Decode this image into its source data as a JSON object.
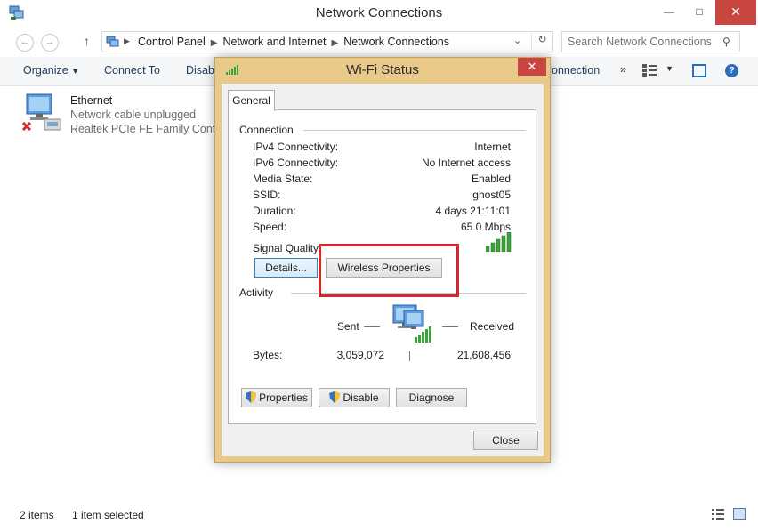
{
  "window": {
    "title": "Network Connections",
    "minimize_icon": "minimize-icon",
    "maximize_icon": "maximize-icon",
    "close_icon": "close-icon"
  },
  "address": {
    "back": "←",
    "forward": "→",
    "up": "↑",
    "breadcrumbs": [
      "Control Panel",
      "Network and Internet",
      "Network Connections"
    ],
    "search_placeholder": "Search Network Connections"
  },
  "toolbar": {
    "organize": "Organize",
    "connect_to": "Connect To",
    "disable": "Disabl",
    "connection": "onnection",
    "more": "»"
  },
  "items": [
    {
      "name": "Ethernet",
      "status": "Network cable unplugged",
      "adapter": "Realtek PCIe FE Family Controll"
    }
  ],
  "statusbar": {
    "count": "2 items",
    "selected": "1 item selected"
  },
  "dialog": {
    "title": "Wi-Fi Status",
    "close": "✕",
    "tab": "General",
    "connection_group": "Connection",
    "rows": [
      {
        "label": "IPv4 Connectivity:",
        "value": "Internet"
      },
      {
        "label": "IPv6 Connectivity:",
        "value": "No Internet access"
      },
      {
        "label": "Media State:",
        "value": "Enabled"
      },
      {
        "label": "SSID:",
        "value": "ghost05"
      },
      {
        "label": "Duration:",
        "value": "4 days 21:11:01"
      },
      {
        "label": "Speed:",
        "value": "65.0 Mbps"
      }
    ],
    "signal_label": "Signal Quality:",
    "signal_bars": 5,
    "details_button": "Details...",
    "wireless_properties_button": "Wireless Properties",
    "activity_group": "Activity",
    "sent_label": "Sent",
    "received_label": "Received",
    "bytes_label": "Bytes:",
    "bytes_sent": "3,059,072",
    "bytes_received": "21,608,456",
    "properties_button": "Properties",
    "disable_button": "Disable",
    "diagnose_button": "Diagnose",
    "close_button": "Close"
  },
  "colors": {
    "accent_close": "#c7463f",
    "dialog_frame": "#e9c98a",
    "highlight": "#d9262a",
    "signal_green": "#3aa33a"
  }
}
